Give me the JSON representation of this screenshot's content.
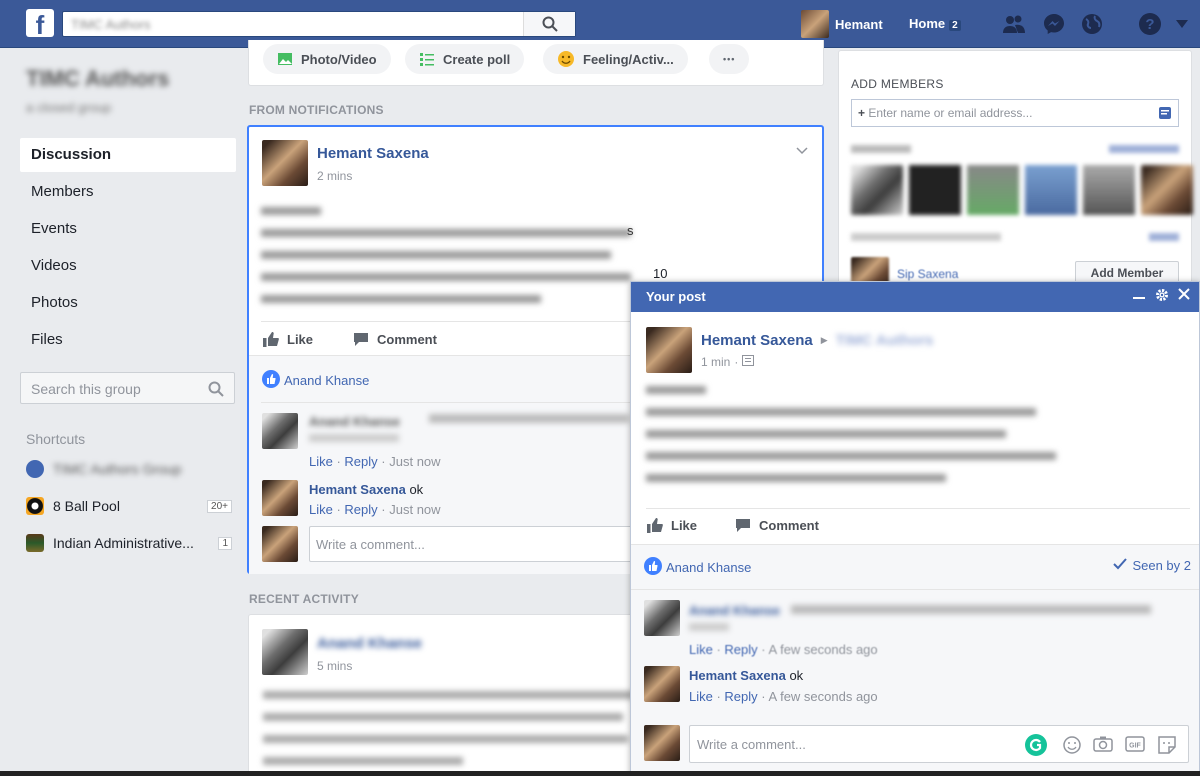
{
  "topbar": {
    "logo": "f",
    "search_value": "TIMC Authors",
    "user_name": "Hemant",
    "home_label": "Home",
    "home_count": "2"
  },
  "group": {
    "name": "TIMC Authors",
    "subtitle": "a closed group"
  },
  "nav": {
    "items": [
      {
        "label": "Discussion"
      },
      {
        "label": "Members"
      },
      {
        "label": "Events"
      },
      {
        "label": "Videos"
      },
      {
        "label": "Photos"
      },
      {
        "label": "Files"
      }
    ],
    "search_placeholder": "Search this group"
  },
  "shortcuts": {
    "heading": "Shortcuts",
    "items": [
      {
        "label": "TIMC Authors Group",
        "badge": ""
      },
      {
        "label": "8 Ball Pool",
        "badge": "20+"
      },
      {
        "label": "Indian Administrative...",
        "badge": "1"
      }
    ]
  },
  "composer": {
    "photo_video": "Photo/Video",
    "create_poll": "Create poll",
    "feeling": "Feeling/Activ...",
    "more": "•••"
  },
  "feed": {
    "from_notifications": "FROM NOTIFICATIONS",
    "recent_activity": "RECENT ACTIVITY",
    "post": {
      "author": "Hemant Saxena",
      "time": "2 mins",
      "visible_fragment_1": "s",
      "visible_fragment_2": "10",
      "like": "Like",
      "comment": "Comment",
      "liker": "Anand Khanse",
      "comments": [
        {
          "author": "Anand Khanse",
          "text": "",
          "like": "Like",
          "reply": "Reply",
          "time": "Just now"
        },
        {
          "author": "Hemant Saxena",
          "text": "ok",
          "like": "Like",
          "reply": "Reply",
          "time": "Just now"
        }
      ],
      "comment_placeholder": "Write a comment..."
    },
    "recent_post": {
      "author": "Anand Khanse",
      "time": "5 mins"
    }
  },
  "right": {
    "add_members_heading": "ADD MEMBERS",
    "add_members_placeholder": "Enter name or email address...",
    "suggested_name": "Sip Saxena",
    "add_member_button": "Add Member"
  },
  "popup": {
    "title": "Your post",
    "author": "Hemant Saxena",
    "group": "TIMC Authors",
    "time": "1 min",
    "like": "Like",
    "comment": "Comment",
    "liker": "Anand Khanse",
    "seen": "Seen by 2",
    "comments": [
      {
        "author": "Anand Khanse",
        "text": "",
        "like": "Like",
        "reply": "Reply",
        "time": "A few seconds ago"
      },
      {
        "author": "Hemant Saxena",
        "text": "ok",
        "like": "Like",
        "reply": "Reply",
        "time": "A few seconds ago"
      }
    ],
    "comment_placeholder": "Write a comment..."
  },
  "colors": {
    "brand": "#3b5998",
    "link": "#365899",
    "highlight": "#4080ff",
    "grammarly": "#15c39a"
  }
}
